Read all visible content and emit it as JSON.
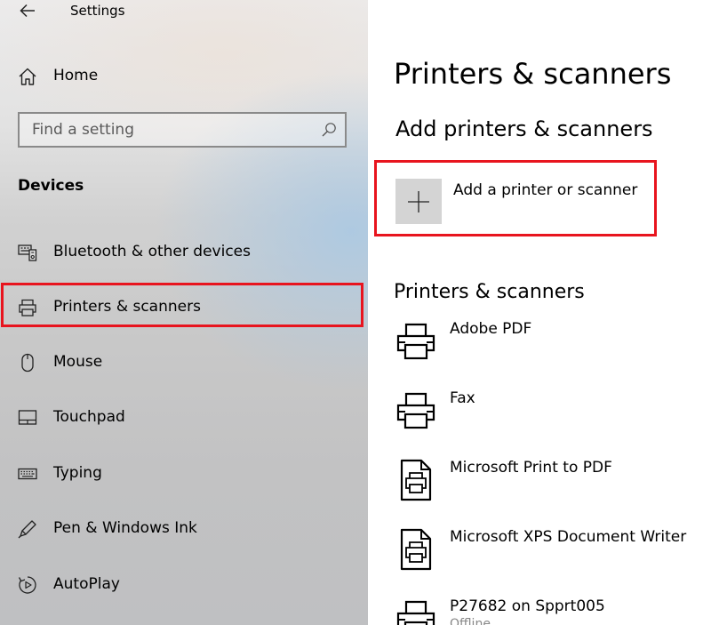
{
  "window": {
    "title": "Settings"
  },
  "sidebar": {
    "home_label": "Home",
    "search_placeholder": "Find a setting",
    "section_title": "Devices",
    "items": [
      {
        "label": "Bluetooth & other devices",
        "icon": "bluetooth-devices-icon"
      },
      {
        "label": "Printers & scanners",
        "icon": "printer-icon",
        "selected": true
      },
      {
        "label": "Mouse",
        "icon": "mouse-icon"
      },
      {
        "label": "Touchpad",
        "icon": "touchpad-icon"
      },
      {
        "label": "Typing",
        "icon": "keyboard-icon"
      },
      {
        "label": "Pen & Windows Ink",
        "icon": "pen-icon"
      },
      {
        "label": "AutoPlay",
        "icon": "autoplay-icon"
      }
    ]
  },
  "main": {
    "page_title": "Printers & scanners",
    "add_section_title": "Add printers & scanners",
    "add_button_label": "Add a printer or scanner",
    "list_title": "Printers & scanners",
    "printers": [
      {
        "name": "Adobe PDF",
        "icon": "printer-icon"
      },
      {
        "name": "Fax",
        "icon": "printer-icon"
      },
      {
        "name": "Microsoft Print to PDF",
        "icon": "document-printer-icon"
      },
      {
        "name": "Microsoft XPS Document Writer",
        "icon": "document-printer-icon"
      },
      {
        "name": "P27682 on Spprt005",
        "status": "Offline",
        "icon": "printer-icon"
      }
    ]
  },
  "colors": {
    "highlight": "#e8141e",
    "sidebar_bg": "#cbcbcb",
    "add_tile": "#d4d4d4"
  }
}
